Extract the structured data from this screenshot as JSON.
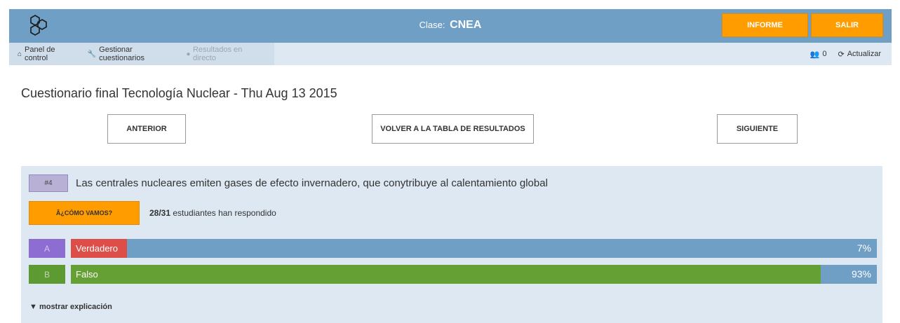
{
  "header": {
    "logo": "molecule-logo-icon",
    "class_prefix": "Clase:",
    "class_name": "CNEA",
    "informe_label": "INFORME",
    "salir_label": "SALIR",
    "accent_color": "#ff9c00",
    "bar_color": "#6f9fc5"
  },
  "nav": {
    "items": [
      {
        "icon": "home-icon",
        "label": "Panel de control"
      },
      {
        "icon": "wrench-icon",
        "label": "Gestionar cuestionarios"
      },
      {
        "icon": "broadcast-icon",
        "label": "Resultados en directo"
      }
    ],
    "users_icon": "users-icon",
    "user_count": "0",
    "refresh_icon": "refresh-icon",
    "refresh_label": "Actualizar"
  },
  "page": {
    "title": "Cuestionario final Tecnología Nuclear - Thu Aug 13 2015",
    "prev_label": "ANTERIOR",
    "back_label": "VOLVER A LA TABLA DE RESULTADOS",
    "next_label": "SIGUIENTE"
  },
  "question": {
    "number": "#4",
    "text": "Las centrales nucleares emiten gases de efecto invernadero, que conytribuye al calentamiento global",
    "how_label": "Â¿CÓMO VAMOS?",
    "responded": "28/31",
    "responded_suffix": "estudiantes han respondido",
    "answers": [
      {
        "letter": "A",
        "label": "Verdadero",
        "percent_text": "7%",
        "percent": 7,
        "letter_color": "#8e6dd2",
        "fill_color": "#de4e48"
      },
      {
        "letter": "B",
        "label": "Falso",
        "percent_text": "93%",
        "percent": 93,
        "letter_color": "#5e9a32",
        "fill_color": "#64a033"
      }
    ],
    "explain_label": "▼ mostrar explicación"
  }
}
